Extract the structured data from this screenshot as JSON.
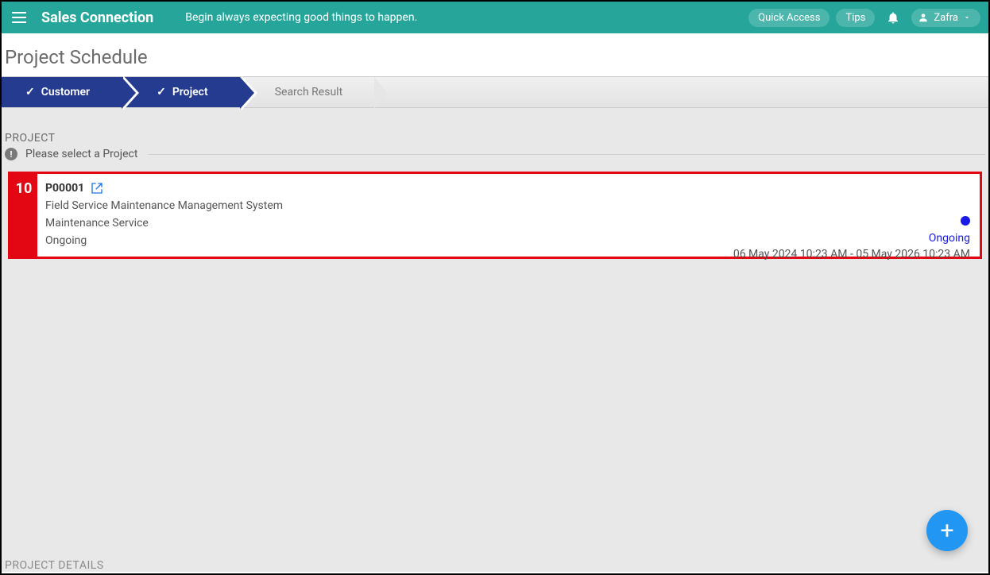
{
  "header": {
    "brand": "Sales Connection",
    "tagline": "Begin always expecting good things to happen.",
    "quick_access": "Quick Access",
    "tips": "Tips",
    "user": "Zafra"
  },
  "page": {
    "title": "Project Schedule"
  },
  "stepper": {
    "customer": "Customer",
    "project": "Project",
    "search": "Search Result"
  },
  "section": {
    "label": "PROJECT",
    "hint": "Please select a Project",
    "details_label": "PROJECT DETAILS"
  },
  "project_card": {
    "badge": "10",
    "code": "P00001",
    "title": "Field Service Maintenance Management System",
    "category": "Maintenance Service",
    "state": "Ongoing",
    "status_label": "Ongoing",
    "date_range": "06 May 2024 10:23 AM - 05 May 2026 10:23 AM"
  },
  "colors": {
    "teal": "#26a69a",
    "step_blue": "#243b8f",
    "highlight_red": "#e30613",
    "status_blue": "#1a1ae6",
    "fab_blue": "#2196f3"
  }
}
